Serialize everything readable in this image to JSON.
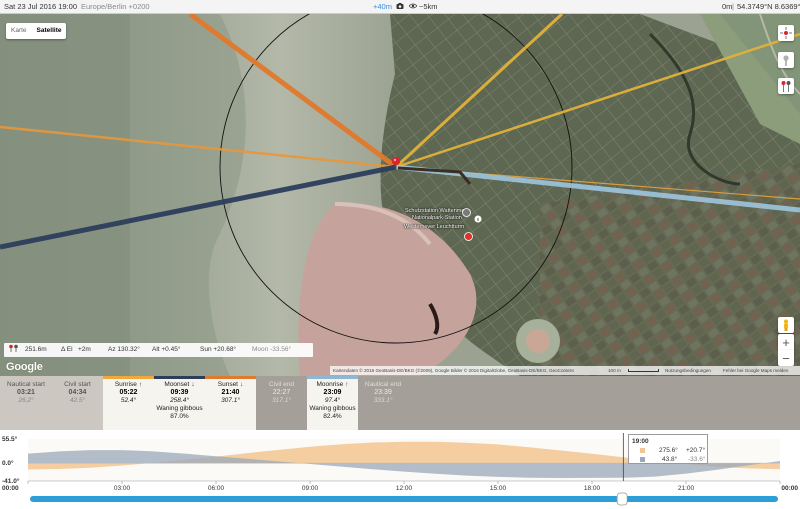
{
  "topbar": {
    "date": "Sat 23 Jul 2016",
    "time": "19:00",
    "timezone": "Europe/Berlin +0200",
    "elevation_offset": "+40m",
    "distance": "~5km",
    "elevation": "0m",
    "coordinates": "54.3749°N 8.6369°E"
  },
  "map": {
    "type_buttons": [
      "Karte",
      "Satellite"
    ],
    "active_type": "Satellite",
    "google_logo": "Google",
    "labels": [
      "Schutzstation Wattenmeer",
      "Nationalpark-Station",
      "Westerhever Leuchtturm"
    ],
    "attribution": "Kartendaten © 2016 GeoBasis-DE/BKG (©2009), Google Bilder © 2016 DigitalGlobe, GeoBasis-DE/BKG, GeoContent",
    "scale": "100 m",
    "terms": "Nutzungsbedingungen",
    "report": "Fehler bei Google Maps melden",
    "infobar": {
      "elevation": "251.6m",
      "delta_el": "Δ El",
      "delta_el_value": "+2m",
      "azimuth": "Az 130.32°",
      "altitude": "Alt +0.45°",
      "sun": "Sun +20.68°",
      "moon": "Moon -33.56°"
    },
    "zoom_in": "+",
    "zoom_out": "−"
  },
  "events": [
    {
      "label": "Nautical start",
      "time": "03:21",
      "azimuth": "26.2°",
      "style": "light",
      "arrow": ""
    },
    {
      "label": "Civil start",
      "time": "04:34",
      "azimuth": "42.5°",
      "style": "light",
      "arrow": ""
    },
    {
      "label": "Sunrise",
      "time": "05:22",
      "azimuth": "52.4°",
      "style": "hl",
      "arrow": "↑",
      "stripe": "#f0a83c"
    },
    {
      "label": "Moonset",
      "time": "09:39",
      "azimuth": "258.4°",
      "phase": "Waning gibbous",
      "illum": "87.0%",
      "style": "hl",
      "arrow": "↓",
      "stripe": "#2c3e5c"
    },
    {
      "label": "Sunset",
      "time": "21:40",
      "azimuth": "307.1°",
      "style": "hl",
      "arrow": "↓",
      "stripe": "#e07a2c"
    },
    {
      "label": "Civil end",
      "time": "22:27",
      "azimuth": "317.1°",
      "style": "dark",
      "arrow": ""
    },
    {
      "label": "Moonrise",
      "time": "23:09",
      "azimuth": "97.4°",
      "phase": "Waning gibbous",
      "illum": "82.4%",
      "style": "hl",
      "arrow": "↑",
      "stripe": "#8fb7d4"
    },
    {
      "label": "Nautical end",
      "time": "23:39",
      "azimuth": "333.1°",
      "style": "dark",
      "arrow": ""
    }
  ],
  "chart_data": {
    "type": "area",
    "x_ticks": [
      "00:00",
      "03:00",
      "06:00",
      "09:00",
      "12:00",
      "15:00",
      "18:00",
      "21:00",
      "00:00"
    ],
    "y_ticks": [
      "55.5°",
      "0.0°",
      "-41.0°"
    ],
    "ylim": [
      -41.0,
      55.5
    ],
    "series": [
      {
        "color": "#f2c690",
        "hours": [
          0,
          1,
          2,
          3,
          4,
          5,
          6,
          7,
          8,
          9,
          10,
          11,
          12,
          13,
          14,
          15,
          16,
          17,
          18,
          19,
          20,
          21,
          22,
          23,
          24
        ],
        "values": [
          -14.5,
          -13.5,
          -10.5,
          -5.5,
          0.5,
          7.5,
          15,
          23,
          30.5,
          37.5,
          43.5,
          47.5,
          49,
          49,
          47,
          43,
          36.5,
          29,
          21.5,
          13.5,
          5.5,
          -2,
          -8.5,
          -12,
          -14
        ]
      },
      {
        "color": "#9aa8ba",
        "hours": [
          0,
          1,
          2,
          3,
          4,
          5,
          6,
          7,
          8,
          9,
          10,
          11,
          12,
          13,
          14,
          15,
          16,
          17,
          18,
          19,
          20,
          21,
          22,
          23,
          24
        ],
        "values": [
          22,
          27,
          30,
          30,
          27,
          22,
          16,
          10,
          4,
          -2,
          -8,
          -14,
          -19.5,
          -24.5,
          -28.5,
          -31.5,
          -33.5,
          -34,
          -33.8,
          -33.6,
          -31,
          -24,
          -15,
          -5,
          5
        ]
      }
    ],
    "current_hour": 19.0
  },
  "tooltip": {
    "time": "19:00",
    "sun_azimuth": "275.6°",
    "sun_altitude": "+20.7°",
    "moon_azimuth": "43.8°",
    "moon_altitude": "-33.6°",
    "sun_color": "#f2c690",
    "moon_color": "#9aa8ba"
  },
  "slider": {
    "value_hours": 19.0,
    "min": 0,
    "max": 24
  }
}
